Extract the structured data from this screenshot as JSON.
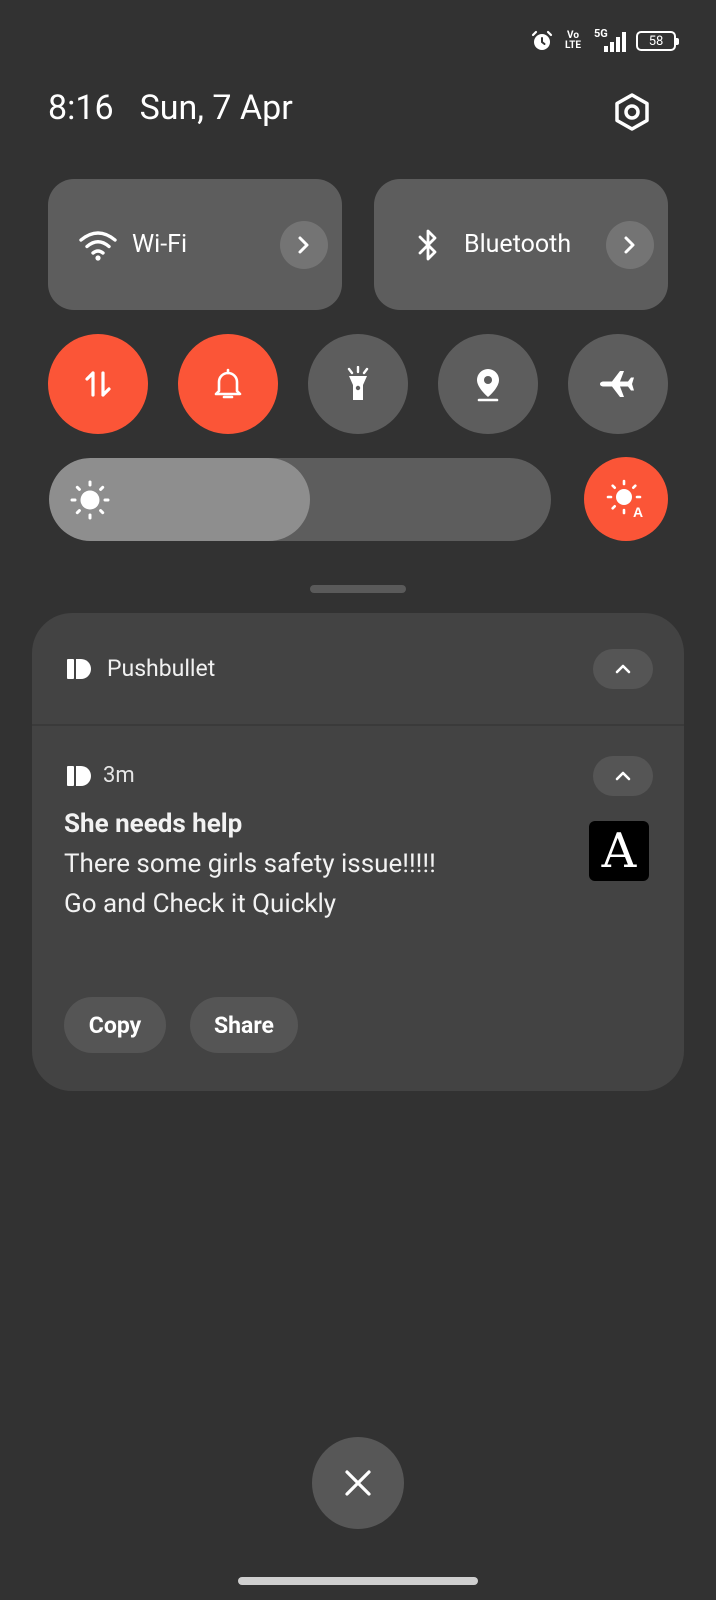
{
  "status_bar": {
    "icons": [
      "alarm-icon",
      "volte-icon",
      "5g-signal-icon",
      "battery-icon"
    ],
    "volte_label": "Vo LTE",
    "network_label": "5G",
    "battery": "58"
  },
  "header": {
    "time": "8:16",
    "date": "Sun, 7 Apr",
    "settings_icon": "gear-icon"
  },
  "tiles": [
    {
      "label": "Wi-Fi",
      "icon": "wifi-icon"
    },
    {
      "label": "Bluetooth",
      "icon": "bluetooth-icon"
    }
  ],
  "toggles": [
    {
      "name": "mobile-data",
      "icon": "data-arrows-icon",
      "active": true
    },
    {
      "name": "sound",
      "icon": "bell-icon",
      "active": true
    },
    {
      "name": "flashlight",
      "icon": "flashlight-icon",
      "active": false
    },
    {
      "name": "location",
      "icon": "location-icon",
      "active": false
    },
    {
      "name": "airplane-mode",
      "icon": "airplane-icon",
      "active": false
    }
  ],
  "brightness": {
    "level_percent": 52,
    "auto_icon": "auto-brightness-icon"
  },
  "colors": {
    "accent": "#fb5537",
    "tile": "#5d5d5d",
    "background": "#323232",
    "card": "#434343"
  },
  "notification": {
    "app_name": "Pushbullet",
    "time_ago": "3m",
    "title": "She needs help",
    "body_lines": [
      "There some girls safety issue!!!!!",
      "Go and Check it Quickly"
    ],
    "thumbnail_letter": "A",
    "actions": [
      "Copy",
      "Share"
    ]
  }
}
